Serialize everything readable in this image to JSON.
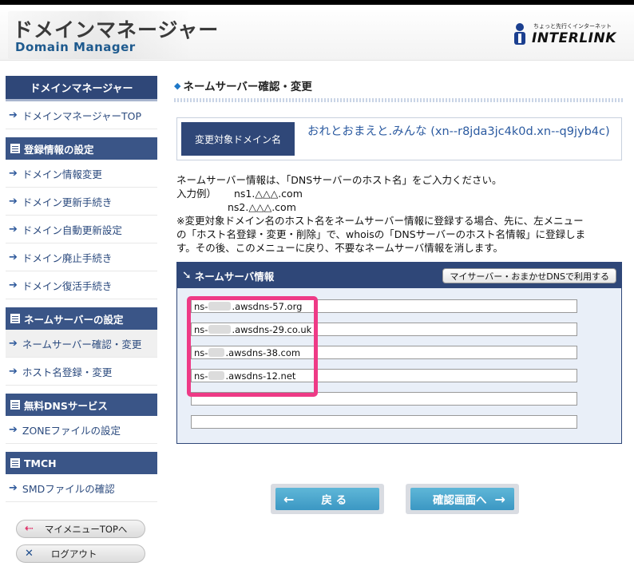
{
  "header": {
    "title_jp": "ドメインマネージャー",
    "title_en": "Domain Manager",
    "brand_tagline": "ちょっと先行くインターネット",
    "brand_name": "INTERLINK"
  },
  "sidebar": {
    "main_label": "ドメインマネージャー",
    "top_item": "ドメインマネージャーTOP",
    "sections": [
      {
        "title": "登録情報の設定",
        "items": [
          "ドメイン情報変更",
          "ドメイン更新手続き",
          "ドメイン自動更新設定",
          "ドメイン廃止手続き",
          "ドメイン復活手続き"
        ]
      },
      {
        "title": "ネームサーバーの設定",
        "items": [
          "ネームサーバー確認・変更",
          "ホスト名登録・変更"
        ]
      },
      {
        "title": "無料DNSサービス",
        "items": [
          "ZONEファイルの設定"
        ]
      },
      {
        "title": "TMCH",
        "items": [
          "SMDファイルの確認"
        ]
      }
    ],
    "my_menu_button": "マイメニューTOPへ",
    "logout_button": "ログアウト"
  },
  "main": {
    "page_title": "ネームサーバー確認・変更",
    "domain_label": "変更対象ドメイン名",
    "domain_value": "おれとおまえと.みんな (xn--r8jda3jc4k0d.xn--q9jyb4c)",
    "notes": {
      "line1": "ネームサーバー情報は、「DNSサーバーのホスト名」をご入力ください。",
      "example_label": "入力例）",
      "example1": "ns1.△△△.com",
      "example2": "ns2.△△△.com",
      "line2": "※変更対象ドメイン名のホスト名をネームサーバー情報に登録する場合、先に、左メニュー",
      "line3": "の「ホスト名登録・変更・削除」で、whoisの「DNSサーバーのホスト名情報」に登録しま",
      "line4": "す。その後、このメニューに戻り、不要なネームサーバ情報を消します。"
    },
    "ns_panel": {
      "title": "ネームサーバ情報",
      "dns_button": "マイサーバー・おまかせDNSで利用する",
      "fields": [
        {
          "prefix": "ns-",
          "suffix": ".awsdns-57.org"
        },
        {
          "prefix": "ns-",
          "suffix": ".awsdns-29.co.uk"
        },
        {
          "prefix": "ns-",
          "suffix": ".awsdns-38.com"
        },
        {
          "prefix": "ns-",
          "suffix": ".awsdns-12.net"
        },
        {
          "prefix": "",
          "suffix": ""
        },
        {
          "prefix": "",
          "suffix": ""
        }
      ]
    },
    "back_button": "戻 る",
    "confirm_button": "確認画面へ"
  },
  "colors": {
    "navy": "#2f4778",
    "link": "#2b5aa0",
    "highlight": "#ee3a86",
    "button": "#3b97c3"
  }
}
